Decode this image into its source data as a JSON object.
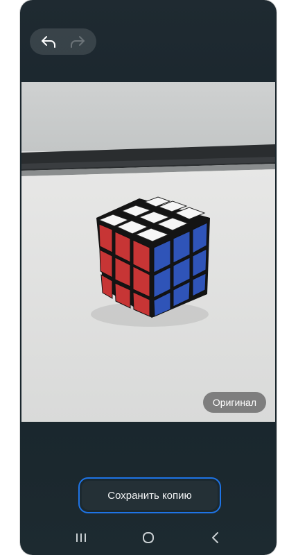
{
  "toolbar": {
    "undo_icon": "undo-arrow-icon",
    "redo_icon": "redo-arrow-icon"
  },
  "photo": {
    "subject": "rubiks-cube-image"
  },
  "original_button": {
    "label": "Оригинал"
  },
  "save_button": {
    "label": "Сохранить копию",
    "accent": "#1e74e6"
  },
  "navbar": {
    "recents_icon": "recents-icon",
    "home_icon": "home-icon",
    "back_icon": "back-icon"
  }
}
